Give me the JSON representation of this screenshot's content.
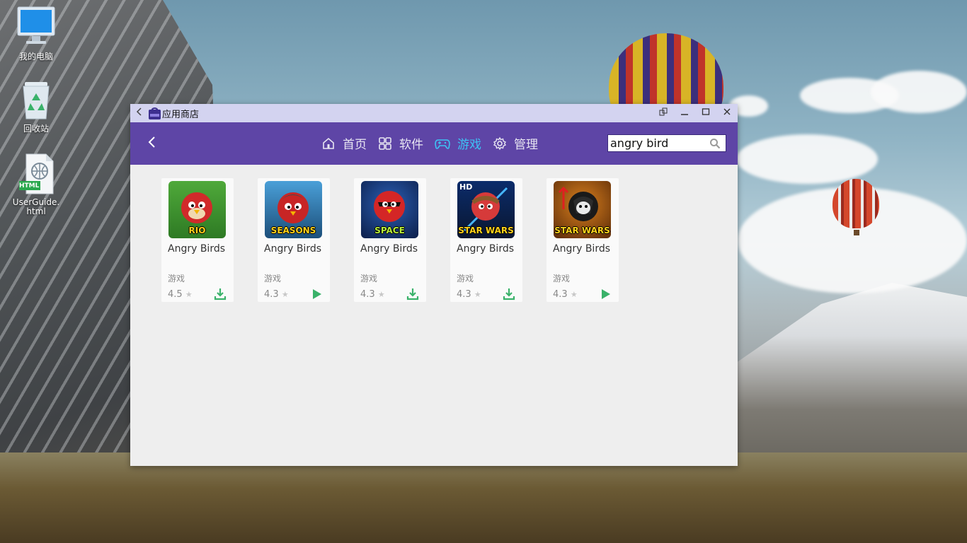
{
  "desktop": {
    "icons": [
      {
        "label": "我的电脑",
        "icon": "computer-icon"
      },
      {
        "label": "回收站",
        "icon": "recycle-bin-icon"
      },
      {
        "label": "UserGuide.html",
        "icon": "html-file-icon",
        "badge": "HTML"
      }
    ]
  },
  "window": {
    "title": "应用商店",
    "titlebar_icons": [
      "back-icon",
      "app-store-icon",
      "restore-icon",
      "minimize-icon",
      "maximize-icon",
      "close-icon"
    ]
  },
  "nav": {
    "tabs": [
      {
        "label": "首页",
        "icon": "home-icon",
        "active": false
      },
      {
        "label": "软件",
        "icon": "grid-icon",
        "active": false
      },
      {
        "label": "游戏",
        "icon": "gamepad-icon",
        "active": true
      },
      {
        "label": "管理",
        "icon": "gear-icon",
        "active": false
      }
    ],
    "search": {
      "value": "angry bird"
    }
  },
  "results": [
    {
      "name": "Angry Birds",
      "category": "游戏",
      "rating": "4.5",
      "action": "download",
      "thumb_text": "RIO",
      "thumb_hd": ""
    },
    {
      "name": "Angry Birds",
      "category": "游戏",
      "rating": "4.3",
      "action": "play",
      "thumb_text": "SEASONS",
      "thumb_hd": ""
    },
    {
      "name": "Angry Birds",
      "category": "游戏",
      "rating": "4.3",
      "action": "download",
      "thumb_text": "SPACE",
      "thumb_hd": ""
    },
    {
      "name": "Angry Birds",
      "category": "游戏",
      "rating": "4.3",
      "action": "download",
      "thumb_text": "STAR WARS",
      "thumb_hd": "HD"
    },
    {
      "name": "Angry Birds",
      "category": "游戏",
      "rating": "4.3",
      "action": "play",
      "thumb_text": "STAR WARS",
      "thumb_hd": ""
    }
  ],
  "colors": {
    "navbar": "#5e45a6",
    "titlebar": "#d3d3f0",
    "active_tab": "#3dc3f5",
    "action_green": "#3ab26a"
  }
}
